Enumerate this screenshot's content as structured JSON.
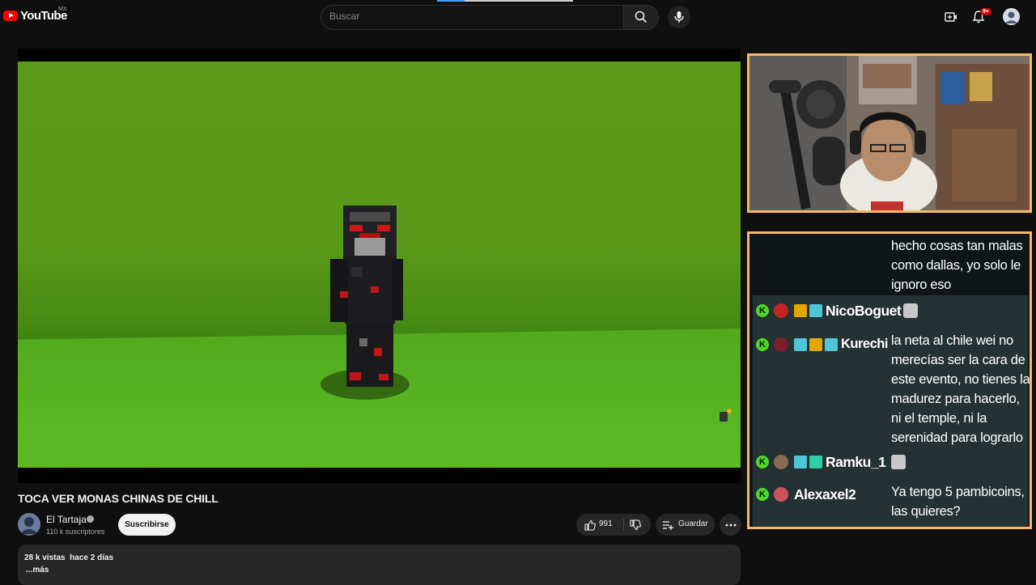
{
  "header": {
    "logo_text": "YouTube",
    "country_code": "MX",
    "search_placeholder": "Buscar",
    "notifications_badge": "9+"
  },
  "video": {
    "title": "TOCA VER MONAS CHINAS DE CHILL",
    "channel_name": "El Tartaja",
    "subscribers": "110 k suscriptores",
    "subscribe_label": "Suscribirse",
    "likes": "991",
    "save_label": "Guardar",
    "views": "28 k vistas",
    "uploaded": "hace 2 días",
    "more_label": "...más"
  },
  "chat": {
    "messages": [
      {
        "username": "",
        "text": "hecho cosas tan malas como dallas, yo solo le ignoro eso"
      },
      {
        "username": "NicoBoguet",
        "text": ""
      },
      {
        "username": "Kurechi",
        "text": "la neta al chile wei no merecías ser la cara de este evento, no tienes la madurez para hacerlo, ni el temple, ni la serenidad para lograrlo"
      },
      {
        "username": "Ramku_1",
        "text": ""
      },
      {
        "username": "Alexaxel2",
        "text": "Ya tengo 5 pambicoins, las quieres?"
      }
    ]
  },
  "colors": {
    "overlay_border": "#f5b869",
    "kick_green": "#4cd82a",
    "chat_bg": "#243234",
    "game_green": "#5ab722"
  }
}
